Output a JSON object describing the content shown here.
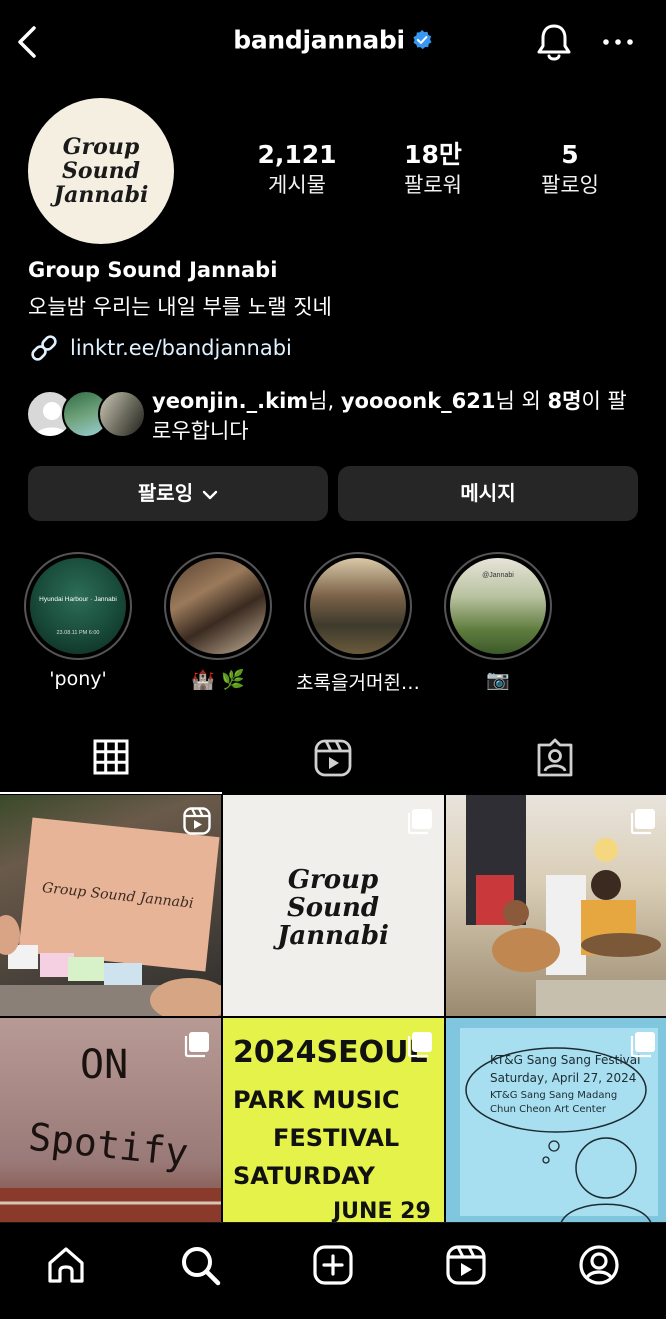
{
  "header": {
    "username": "bandjannabi"
  },
  "profile": {
    "avatar_text": [
      "Group",
      "Sound",
      "Jannabi"
    ],
    "stats": [
      {
        "value": "2,121",
        "label": "게시물"
      },
      {
        "value": "18만",
        "label": "팔로워"
      },
      {
        "value": "5",
        "label": "팔로잉"
      }
    ],
    "display_name": "Group Sound Jannabi",
    "bio": "오늘밤 우리는 내일 부를 노랠 짓네",
    "link": "linktr.ee/bandjannabi"
  },
  "followed_by": {
    "user1": "yeonjin._.kim",
    "sep1": "님, ",
    "user2": "yoooonk_621",
    "sep2": "님 외 ",
    "count": "8명",
    "suffix": "이 팔로우합니다"
  },
  "buttons": {
    "following": "팔로잉",
    "message": "메시지"
  },
  "highlights": [
    {
      "label": "'pony'",
      "thumb_text": "Hyundai Harbour · Jannabi",
      "thumb_sub": "23.08.11 PM 6:00"
    },
    {
      "label": "🏰 🌿"
    },
    {
      "label": "초록을거머쥔…"
    },
    {
      "label": "📷",
      "thumb_text": "@Jannabi"
    }
  ],
  "posts": [
    {
      "kind": "reel",
      "text": "Group Sound Jannabi"
    },
    {
      "kind": "carousel",
      "text": [
        "Group",
        "Sound",
        "Jannabi"
      ]
    },
    {
      "kind": "carousel"
    },
    {
      "kind": "carousel",
      "text": [
        "ON",
        "Spotify"
      ]
    },
    {
      "kind": "carousel",
      "text": [
        "2024SEOUL",
        "PARK MUSIC",
        "FESTIVAL",
        "SATURDAY",
        "JUNE 29"
      ]
    },
    {
      "kind": "carousel",
      "text": [
        "KT&G Sang Sang Festival",
        "Saturday, April 27, 2024",
        "KT&G Sang Sang Madang",
        "Chun Cheon Art Center"
      ]
    }
  ],
  "colors": {
    "background": "#000000",
    "button": "#262626",
    "verified": "#3897f0",
    "link": "#e0f1ff"
  }
}
